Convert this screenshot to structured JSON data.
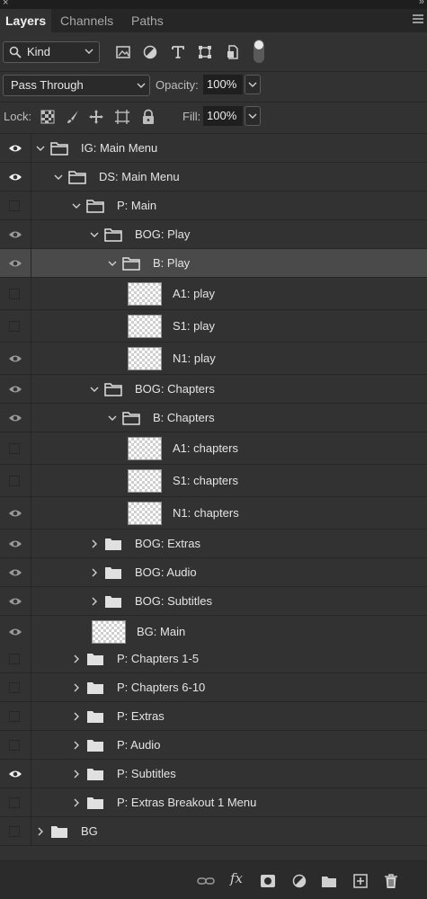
{
  "window": {
    "close_glyph": "×",
    "collapse_glyph": "»"
  },
  "tabs": [
    {
      "label": "Layers",
      "active": true
    },
    {
      "label": "Channels",
      "active": false
    },
    {
      "label": "Paths",
      "active": false
    }
  ],
  "filter": {
    "kind_label": "Kind"
  },
  "blend": {
    "mode": "Pass Through",
    "opacity_label": "Opacity:",
    "opacity_value": "100%",
    "fill_label": "Fill:",
    "fill_value": "100%",
    "lock_label": "Lock:"
  },
  "layers": [
    {
      "name": "IG: Main Menu",
      "type": "group",
      "expanded": true,
      "visible": true
    },
    {
      "name": "DS: Main Menu",
      "type": "group",
      "expanded": true,
      "visible": true
    },
    {
      "name": "P: Main",
      "type": "group",
      "expanded": true,
      "visible": false
    },
    {
      "name": "BOG: Play",
      "type": "group",
      "expanded": true,
      "visible": true
    },
    {
      "name": "B: Play",
      "type": "group",
      "expanded": true,
      "visible": true,
      "selected": true
    },
    {
      "name": "A1: play",
      "type": "layer",
      "visible": false
    },
    {
      "name": "S1: play",
      "type": "layer",
      "visible": false
    },
    {
      "name": "N1: play",
      "type": "layer",
      "visible": true
    },
    {
      "name": "BOG: Chapters",
      "type": "group",
      "expanded": true,
      "visible": true
    },
    {
      "name": "B: Chapters",
      "type": "group",
      "expanded": true,
      "visible": true
    },
    {
      "name": "A1: chapters",
      "type": "layer",
      "visible": false
    },
    {
      "name": "S1: chapters",
      "type": "layer",
      "visible": false
    },
    {
      "name": "N1: chapters",
      "type": "layer",
      "visible": true
    },
    {
      "name": "BOG: Extras",
      "type": "group",
      "expanded": false,
      "visible": true
    },
    {
      "name": "BOG: Audio",
      "type": "group",
      "expanded": false,
      "visible": true
    },
    {
      "name": "BOG: Subtitles",
      "type": "group",
      "expanded": false,
      "visible": true
    },
    {
      "name": "BG: Main",
      "type": "layer",
      "visible": true
    },
    {
      "name": "P: Chapters 1-5",
      "type": "group",
      "expanded": false,
      "visible": false
    },
    {
      "name": "P: Chapters 6-10",
      "type": "group",
      "expanded": false,
      "visible": false
    },
    {
      "name": "P: Extras",
      "type": "group",
      "expanded": false,
      "visible": false
    },
    {
      "name": "P: Audio",
      "type": "group",
      "expanded": false,
      "visible": false
    },
    {
      "name": "P: Subtitles",
      "type": "group",
      "expanded": false,
      "visible": true
    },
    {
      "name": "P: Extras Breakout 1 Menu",
      "type": "group",
      "expanded": false,
      "visible": false
    },
    {
      "name": "BG",
      "type": "group",
      "expanded": false,
      "visible": false
    }
  ],
  "icons": {
    "filter": [
      "image-filter-icon",
      "adjustment-filter-icon",
      "type-filter-icon",
      "shape-filter-icon",
      "smart-object-filter-icon"
    ],
    "lock": [
      "lock-transparent-icon",
      "lock-image-icon",
      "lock-position-icon",
      "lock-artboard-icon",
      "lock-all-icon"
    ],
    "bottom": [
      "link-layers-icon",
      "fx-icon",
      "add-mask-icon",
      "new-adjustment-icon",
      "new-group-icon",
      "new-layer-icon",
      "delete-icon"
    ]
  },
  "bottom_fx_label": "fx"
}
